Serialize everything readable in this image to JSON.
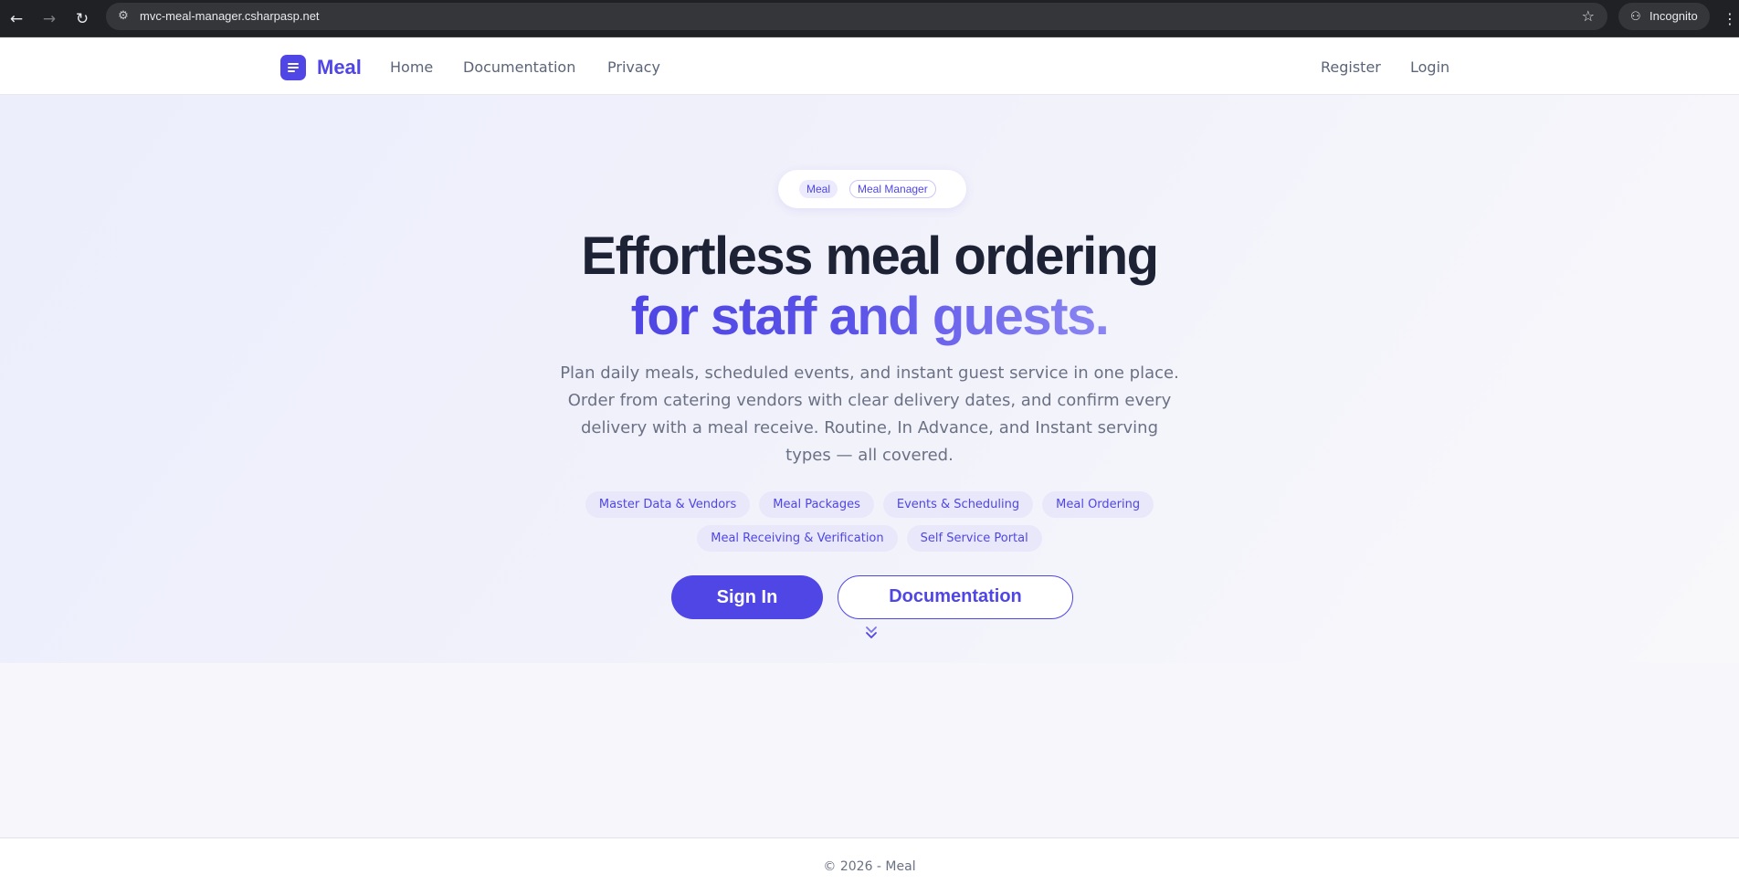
{
  "browser": {
    "back_icon": "←",
    "forward_icon": "→",
    "reload_icon": "↻",
    "site_info_icon": "⚙",
    "url": "mvc-meal-manager.csharpasp.net",
    "star_icon": "☆",
    "incognito_icon": "⚇",
    "incognito_label": "Incognito",
    "menu_icon": "⋮"
  },
  "navbar": {
    "brand": "Meal",
    "links": [
      "Home",
      "Documentation",
      "Privacy"
    ],
    "auth": [
      "Register",
      "Login"
    ]
  },
  "hero": {
    "badges": [
      "Meal",
      "Meal Manager"
    ],
    "title_line1": "Effortless meal ordering",
    "title_line2": "for staff and guests.",
    "description": "Plan daily meals, scheduled events, and instant guest service in one place. Order from catering vendors with clear delivery dates, and confirm every delivery with a meal receive. Routine, In Advance, and Instant serving types — all covered.",
    "tags": [
      "Master Data & Vendors",
      "Meal Packages",
      "Events & Scheduling",
      "Meal Ordering",
      "Meal Receiving & Verification",
      "Self Service Portal"
    ],
    "primary_button": "Sign In",
    "secondary_button": "Documentation",
    "scroll_icon": "chevrons-down-icon"
  },
  "footer": {
    "text": "© 2026 - Meal"
  },
  "colors": {
    "accent": "#4f46e5",
    "heading": "#1e2235",
    "muted": "#6b7184",
    "tag_bg": "#e9e8fb"
  }
}
